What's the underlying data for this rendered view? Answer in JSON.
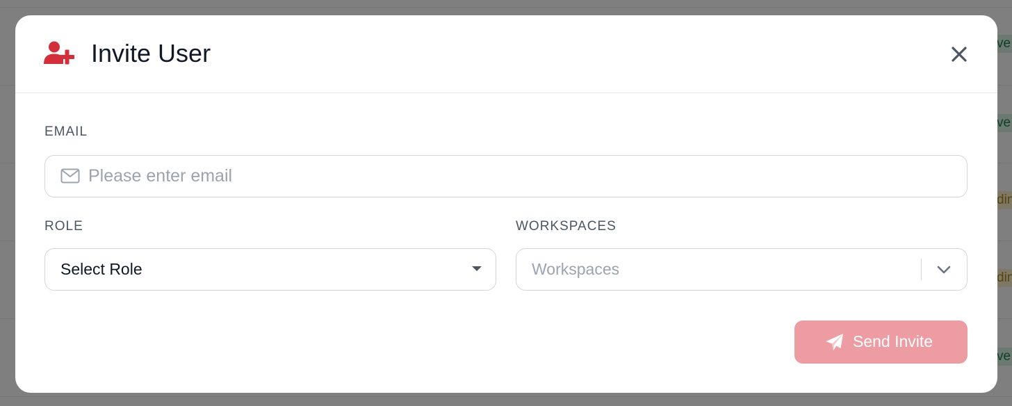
{
  "background": {
    "badges": [
      {
        "text": "ve",
        "tone": "green"
      },
      {
        "text": "ve",
        "tone": "green"
      },
      {
        "text": "din",
        "tone": "yellow"
      },
      {
        "text": "din",
        "tone": "yellow"
      },
      {
        "text": "ve",
        "tone": "green"
      }
    ]
  },
  "modal": {
    "title": "Invite User",
    "header_icon": "user-plus-icon",
    "close_icon": "close-icon",
    "accent_color": "#d32f3a"
  },
  "form": {
    "email": {
      "label": "EMAIL",
      "placeholder": "Please enter email",
      "value": "",
      "icon": "envelope-icon"
    },
    "role": {
      "label": "ROLE",
      "selected": "Select Role",
      "icon": "caret-down-icon"
    },
    "workspaces": {
      "label": "WORKSPACES",
      "placeholder": "Workspaces",
      "icon": "chevron-down-icon"
    },
    "submit": {
      "label": "Send Invite",
      "icon": "paper-plane-icon",
      "color": "#ee9ca3"
    }
  }
}
